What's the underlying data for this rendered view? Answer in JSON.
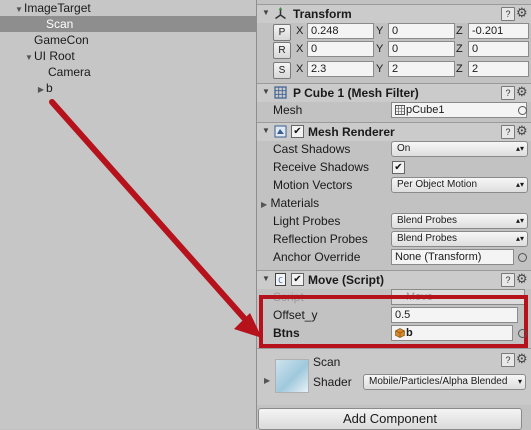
{
  "hierarchy": {
    "items": [
      {
        "label": "ImageTarget",
        "selected": false,
        "expanded": true,
        "has_children": true
      },
      {
        "label": "Scan",
        "selected": true,
        "expanded": false,
        "has_children": false
      },
      {
        "label": "GameCon",
        "selected": false,
        "expanded": false,
        "has_children": false
      },
      {
        "label": "UI Root",
        "selected": false,
        "expanded": true,
        "has_children": true
      },
      {
        "label": "Camera",
        "selected": false,
        "expanded": false,
        "has_children": false
      },
      {
        "label": "b",
        "selected": false,
        "expanded": false,
        "has_children": true
      }
    ]
  },
  "inspector": {
    "transform": {
      "title": "Transform",
      "position": {
        "button": "P",
        "x": "0.248",
        "y": "0",
        "z": "-0.201"
      },
      "rotation": {
        "button": "R",
        "x": "0",
        "y": "0",
        "z": "0"
      },
      "scale": {
        "button": "S",
        "x": "2.3",
        "y": "2",
        "z": "2"
      },
      "axis_labels": {
        "x": "X",
        "y": "Y",
        "z": "Z"
      }
    },
    "mesh_filter": {
      "title": "P Cube 1 (Mesh Filter)",
      "mesh_label": "Mesh",
      "mesh_value": "pCube1"
    },
    "mesh_renderer": {
      "title": "Mesh Renderer",
      "enabled": true,
      "cast_shadows_label": "Cast Shadows",
      "cast_shadows_value": "On",
      "receive_shadows_label": "Receive Shadows",
      "receive_shadows_checked": true,
      "motion_vectors_label": "Motion Vectors",
      "motion_vectors_value": "Per Object Motion",
      "materials_label": "Materials",
      "light_probes_label": "Light Probes",
      "light_probes_value": "Blend Probes",
      "reflection_probes_label": "Reflection Probes",
      "reflection_probes_value": "Blend Probes",
      "anchor_override_label": "Anchor Override",
      "anchor_override_value": "None (Transform)"
    },
    "move_script": {
      "title": "Move (Script)",
      "enabled": true,
      "script_label": "Script",
      "script_value": "Move",
      "offset_label": "Offset_y",
      "offset_value": "0.5",
      "btns_label": "Btns",
      "btns_value": "b"
    },
    "material": {
      "name": "Scan",
      "shader_label": "Shader",
      "shader_value": "Mobile/Particles/Alpha Blended"
    },
    "add_component_label": "Add Component"
  },
  "colors": {
    "annotation_red": "#b5121b",
    "selection": "#8e8e8e"
  }
}
